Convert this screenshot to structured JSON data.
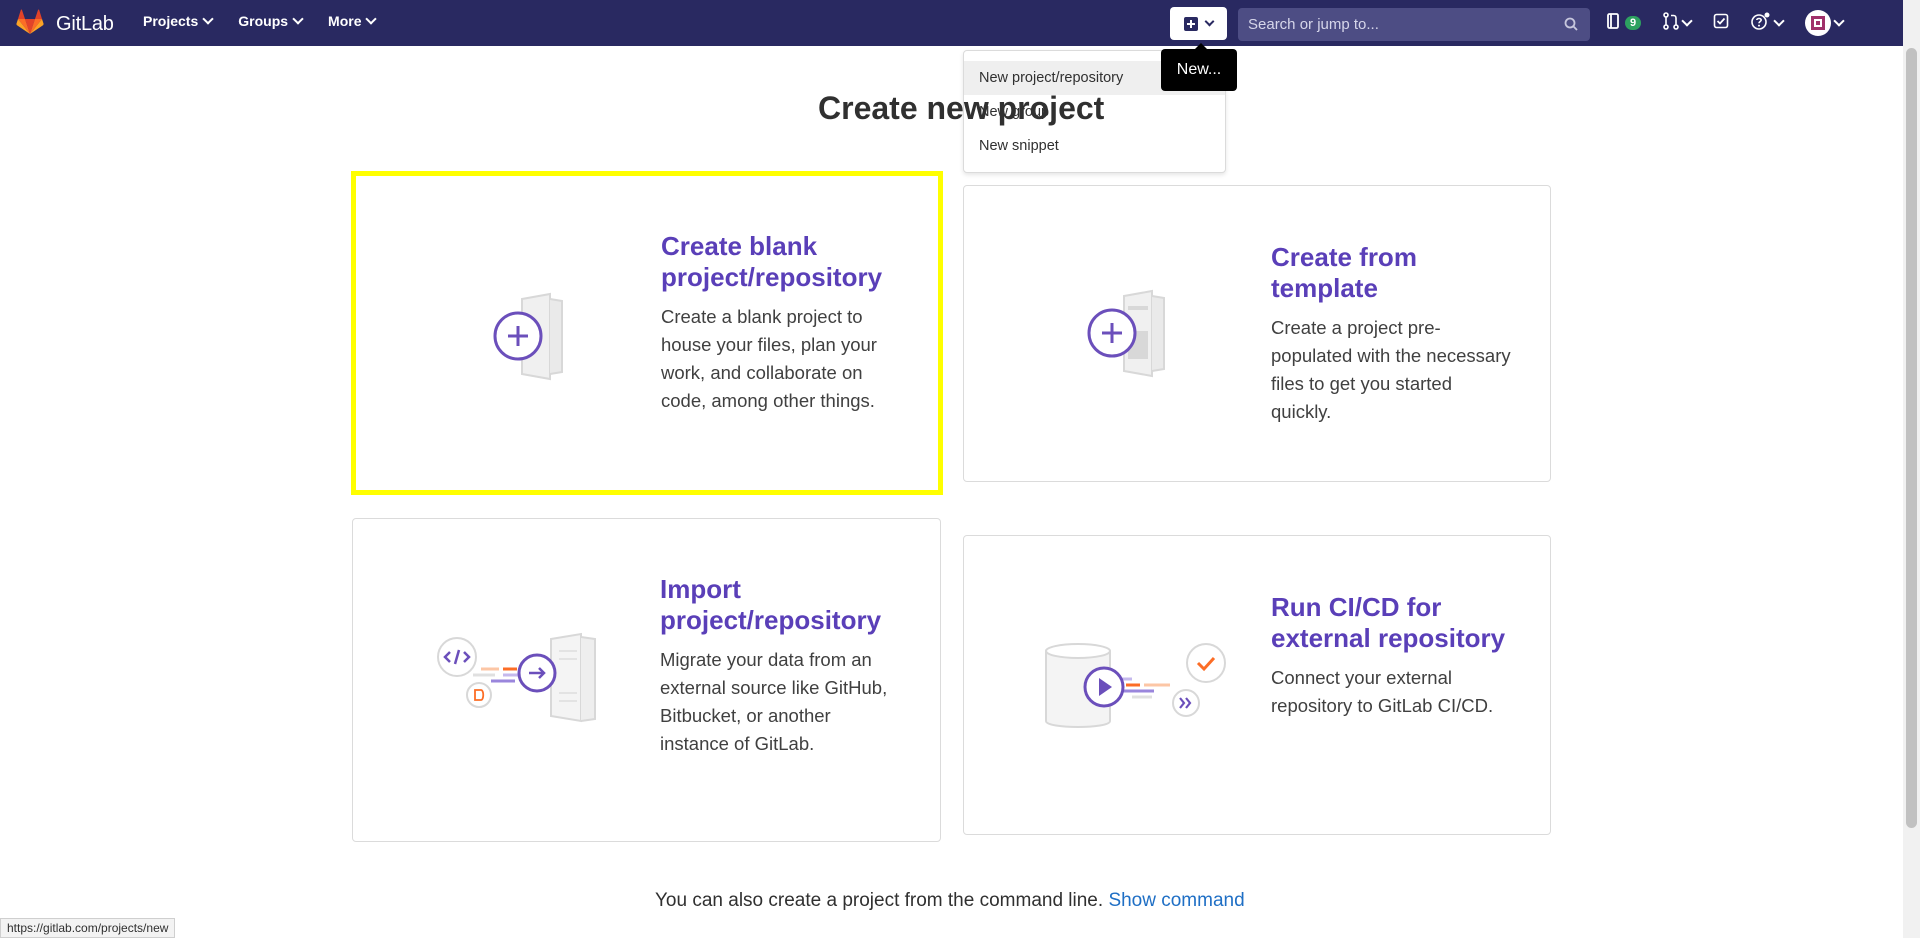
{
  "navbar": {
    "brand": "GitLab",
    "menu": [
      {
        "label": "Projects"
      },
      {
        "label": "Groups"
      },
      {
        "label": "More"
      }
    ],
    "search_placeholder": "Search or jump to...",
    "issues_count": "9"
  },
  "new_dropdown": {
    "tooltip": "New...",
    "items": [
      {
        "label": "New project/repository"
      },
      {
        "label": "New group"
      },
      {
        "label": "New snippet"
      }
    ]
  },
  "page": {
    "title": "Create new project"
  },
  "cards": [
    {
      "title": "Create blank project/repository",
      "description": "Create a blank project to house your files, plan your work, and collaborate on code, among other things."
    },
    {
      "title": "Create from template",
      "description": "Create a project pre-populated with the necessary files to get you started quickly."
    },
    {
      "title": "Import project/repository",
      "description": "Migrate your data from an external source like GitHub, Bitbucket, or another instance of GitLab."
    },
    {
      "title": "Run CI/CD for external repository",
      "description": "Connect your external repository to GitLab CI/CD."
    }
  ],
  "footer": {
    "text": "You can also create a project from the command line.",
    "link": "Show command"
  },
  "status_url": "https://gitlab.com/projects/new",
  "colors": {
    "navbar": "#292961",
    "accent_purple": "#5a3fb8",
    "highlight": "#ffff00",
    "link": "#1f6fc5"
  }
}
